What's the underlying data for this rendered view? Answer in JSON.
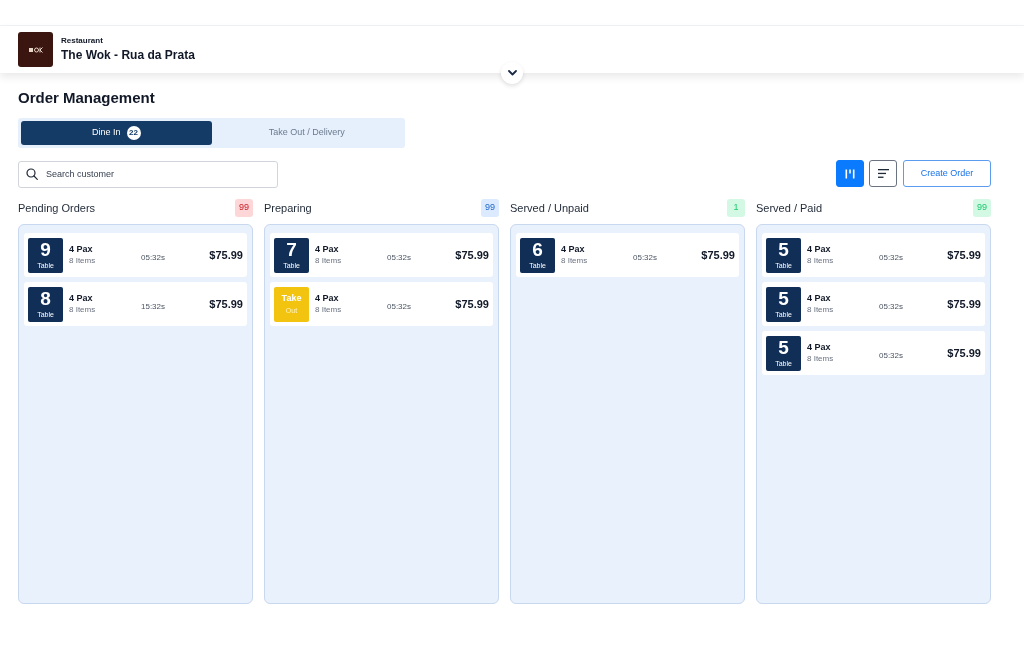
{
  "header": {
    "category": "Restaurant",
    "name": "The Wok - Rua da Prata"
  },
  "page_title": "Order Management",
  "tabs": [
    {
      "label": "Dine In",
      "count": "22",
      "selected": true
    },
    {
      "label": "Take Out / Delivery",
      "selected": false
    }
  ],
  "search": {
    "placeholder": "Search customer"
  },
  "view_buttons": [
    {
      "kind": "board",
      "selected": true
    },
    {
      "kind": "list",
      "selected": false
    }
  ],
  "create_button": "Create Order",
  "columns": [
    {
      "title": "Pending Orders",
      "count": "99",
      "color": "#fdd6d8",
      "orders": [
        {
          "kind": "table",
          "tile_main": "9",
          "tile_sub": "Table",
          "pax": "4 Pax",
          "items": "8 Items",
          "time": "05:32s",
          "price": "$75.99"
        },
        {
          "kind": "table",
          "tile_main": "8",
          "tile_sub": "Table",
          "pax": "4 Pax",
          "items": "8 Items",
          "time": "15:32s",
          "price": "$75.99"
        }
      ]
    },
    {
      "title": "Preparing",
      "count": "99",
      "color": "#dbeafe",
      "orders": [
        {
          "kind": "table",
          "tile_main": "7",
          "tile_sub": "Table",
          "pax": "4 Pax",
          "items": "8 Items",
          "time": "05:32s",
          "price": "$75.99"
        },
        {
          "kind": "take_out",
          "tile_main": "Take",
          "tile_sub": "Out",
          "pax": "4 Pax",
          "items": "8 Items",
          "time": "05:32s",
          "price": "$75.99"
        }
      ]
    },
    {
      "title": "Served / Unpaid",
      "count": "1",
      "color": "#d3f8e4",
      "orders": [
        {
          "kind": "table",
          "tile_main": "6",
          "tile_sub": "Table",
          "pax": "4 Pax",
          "items": "8 Items",
          "time": "05:32s",
          "price": "$75.99"
        }
      ]
    },
    {
      "title": "Served / Paid",
      "count": "99",
      "color": "#d3f8e4",
      "orders": [
        {
          "kind": "table",
          "tile_main": "5",
          "tile_sub": "Table",
          "pax": "4 Pax",
          "items": "8 Items",
          "time": "05:32s",
          "price": "$75.99"
        },
        {
          "kind": "table",
          "tile_main": "5",
          "tile_sub": "Table",
          "pax": "4 Pax",
          "items": "8 Items",
          "time": "05:32s",
          "price": "$75.99"
        },
        {
          "kind": "table",
          "tile_main": "5",
          "tile_sub": "Table",
          "pax": "4 Pax",
          "items": "8 Items",
          "time": "05:32s",
          "price": "$75.99"
        }
      ]
    }
  ]
}
